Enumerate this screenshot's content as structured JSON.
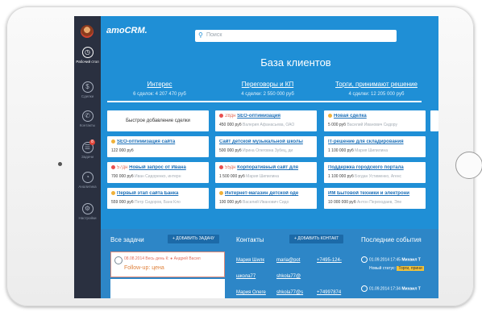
{
  "app": {
    "logo": "amoCRM."
  },
  "search": {
    "placeholder": "Поиск"
  },
  "sidebar": {
    "items": [
      {
        "label": "Рабочий стол",
        "icon": "dashboard-icon"
      },
      {
        "label": "Сделки",
        "icon": "dollar-icon"
      },
      {
        "label": "Контакты",
        "icon": "phone-icon"
      },
      {
        "label": "Задачи",
        "icon": "tasks-icon",
        "badge": "8"
      },
      {
        "label": "Аналитика",
        "icon": "analytics-icon"
      },
      {
        "label": "Настройки",
        "icon": "settings-icon"
      }
    ]
  },
  "main": {
    "title": "База клиентов",
    "stages": [
      {
        "name": "Интерес",
        "info": "6 сделок: 4 207 470 руб"
      },
      {
        "name": "Переговоры и КП",
        "info": "4 сделки: 2 550 000 руб"
      },
      {
        "name": "Торги, принимают решение",
        "info": "4 сделки: 12 205 000 руб"
      }
    ],
    "quick_add": "Быстрое добавление сделки",
    "cards": {
      "c0_1": {
        "ago": "28дн",
        "title": "SEO-оптимизация",
        "price": "450 000 руб",
        "contact": "Валерия Афанасьева, ОАО",
        "dot": "#e94f4f"
      },
      "c0_2": {
        "ago": "",
        "title": "SEO-оптимизация сайта",
        "price": "122 000 руб",
        "contact": "",
        "dot": "#f0b13a"
      },
      "c0_3": {
        "ago": "57дн",
        "title": "Новый запрос от Ивана",
        "price": "700 000 руб",
        "contact": "Иван Сидоренко, интерн",
        "dot": "#e94f4f"
      },
      "c0_4": {
        "ago": "",
        "title": "Первый этап сайта Банка",
        "price": "559 000 руб",
        "contact": "Петр Сидоров, Банк Кло",
        "dot": "#f0b13a"
      },
      "c1_1": {
        "ago": "",
        "title": "Сайт детской музыкальной школы",
        "price": "500 000 руб",
        "contact": "Ирина Олеговна Зубец, ди",
        "dot": ""
      },
      "c1_2": {
        "ago": "55дн",
        "title": "Корпоративный сайт для",
        "price": "1 500 000 руб",
        "contact": "Мария Шипилина",
        "dot": "#e94f4f"
      },
      "c1_3": {
        "ago": "",
        "title": "Интернет-магазин детской оде",
        "price": "100 000 руб",
        "contact": "Василий Иванович Сидо",
        "dot": "#f0b13a"
      },
      "c2_0": {
        "ago": "",
        "title": "Новая сделка",
        "price": "5 000 руб",
        "contact": "Василий Иванович Сидору",
        "dot": "#f0b13a"
      },
      "c2_1": {
        "ago": "",
        "title": "IT-решение для складирования",
        "price": "1 100 000 руб",
        "contact": "Мария Шипилина",
        "dot": ""
      },
      "c2_2": {
        "ago": "",
        "title": "Поддержка городского портала",
        "price": "1 100 000 руб",
        "contact": "Богдан Устименко, Агенс",
        "dot": ""
      },
      "c2_3": {
        "ago": "",
        "title": "ИМ Бытовой техники и электрони",
        "price": "10 000 000 руб",
        "contact": "Антон Переходаев, Эле",
        "dot": ""
      }
    }
  },
  "bottom": {
    "tasks": {
      "title": "Все задачи",
      "add": "+ ДОБАВИТЬ ЗАДАЧУ",
      "item1_date": "08.08.2014 Весь день К: ● Андрей Васил",
      "item1_text": "Follow-up: цена"
    },
    "contacts": {
      "title": "Контакты",
      "add": "+ ДОБАВИТЬ КОНТАКТ",
      "rows": [
        {
          "name": "Мария Шилк",
          "email": "maria@pot",
          "phone": "+7495-124-"
        },
        {
          "name": "школа77",
          "email": "shkola77@",
          "phone": ""
        },
        {
          "name": "Мария Олеге",
          "email": "shkola77@s",
          "phone": "+74997874"
        }
      ]
    },
    "events": {
      "title": "Последние события",
      "e1_time": "01.09.2014 17:45",
      "e1_user": "Михаил Т",
      "e1_line2": "Новый статус:",
      "e1_status": "Торги, прини",
      "e2_time": "01.09.2014 17:34",
      "e2_user": "Михаил Т"
    }
  },
  "colors": {
    "main": "#1f8fd6",
    "sidebar": "#2a3040",
    "alert": "#e94f4f",
    "warning": "#f0b13a"
  }
}
